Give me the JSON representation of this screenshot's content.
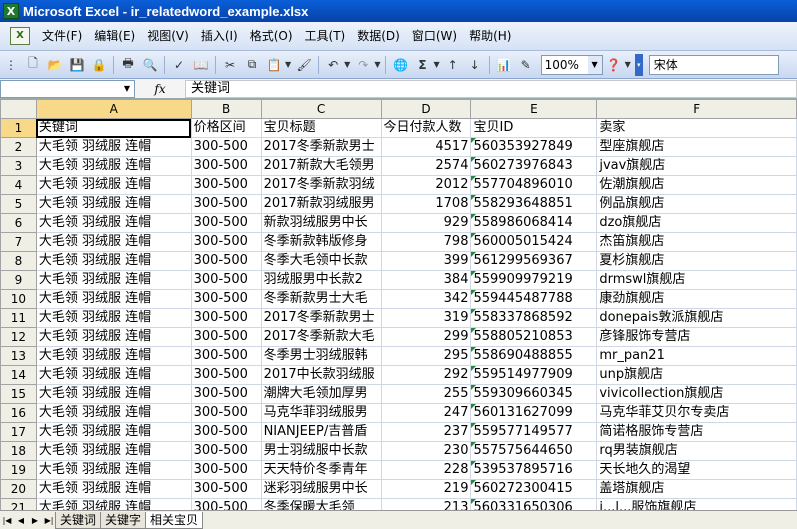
{
  "window": {
    "title": "Microsoft Excel - ir_relatedword_example.xlsx",
    "app_icon": "excel-icon"
  },
  "menu": [
    "文件(F)",
    "编辑(E)",
    "视图(V)",
    "插入(I)",
    "格式(O)",
    "工具(T)",
    "数据(D)",
    "窗口(W)",
    "帮助(H)"
  ],
  "toolbar": {
    "zoom": "100%",
    "font": "宋体",
    "sum_label": "Σ"
  },
  "formula_bar": {
    "name_box": "",
    "fx_label": "fx",
    "content": "关键词"
  },
  "columns": [
    "A",
    "B",
    "C",
    "D",
    "E",
    "F"
  ],
  "rows": [
    {
      "n": "1",
      "cells": [
        "关键词",
        "价格区间",
        "宝贝标题",
        "今日付款人数",
        "宝贝ID",
        "卖家"
      ]
    },
    {
      "n": "2",
      "cells": [
        "大毛领 羽绒服 连帽",
        "300-500",
        "2017冬季新款男士",
        "4517",
        "560353927849",
        "型座旗舰店"
      ]
    },
    {
      "n": "3",
      "cells": [
        "大毛领 羽绒服 连帽",
        "300-500",
        "2017新款大毛领男",
        "2574",
        "560273976843",
        "jvav旗舰店"
      ]
    },
    {
      "n": "4",
      "cells": [
        "大毛领 羽绒服 连帽",
        "300-500",
        "2017冬季新款羽绒",
        "2012",
        "557704896010",
        "佐潮旗舰店"
      ]
    },
    {
      "n": "5",
      "cells": [
        "大毛领 羽绒服 连帽",
        "300-500",
        "2017新款羽绒服男",
        "1708",
        "558293648851",
        "例品旗舰店"
      ]
    },
    {
      "n": "6",
      "cells": [
        "大毛领 羽绒服 连帽",
        "300-500",
        "新款羽绒服男中长",
        "929",
        "558986068414",
        "dzo旗舰店"
      ]
    },
    {
      "n": "7",
      "cells": [
        "大毛领 羽绒服 连帽",
        "300-500",
        "冬季新款韩版修身",
        "798",
        "560005015424",
        "杰笛旗舰店"
      ]
    },
    {
      "n": "8",
      "cells": [
        "大毛领 羽绒服 连帽",
        "300-500",
        "冬季大毛领中长款",
        "399",
        "561299569367",
        "夏杉旗舰店"
      ]
    },
    {
      "n": "9",
      "cells": [
        "大毛领 羽绒服 连帽",
        "300-500",
        "羽绒服男中长款2",
        "384",
        "559909979219",
        "drmswl旗舰店"
      ]
    },
    {
      "n": "10",
      "cells": [
        "大毛领 羽绒服 连帽",
        "300-500",
        "冬季新款男士大毛",
        "342",
        "559445487788",
        "康劲旗舰店"
      ]
    },
    {
      "n": "11",
      "cells": [
        "大毛领 羽绒服 连帽",
        "300-500",
        "2017冬季新款男士",
        "319",
        "558337868592",
        "donepais敦派旗舰店"
      ]
    },
    {
      "n": "12",
      "cells": [
        "大毛领 羽绒服 连帽",
        "300-500",
        "2017冬季新款大毛",
        "299",
        "558805210853",
        "彦锋服饰专营店"
      ]
    },
    {
      "n": "13",
      "cells": [
        "大毛领 羽绒服 连帽",
        "300-500",
        "冬季男士羽绒服韩",
        "295",
        "558690488855",
        "mr_pan21"
      ]
    },
    {
      "n": "14",
      "cells": [
        "大毛领 羽绒服 连帽",
        "300-500",
        "2017中长款羽绒服",
        "292",
        "559514977909",
        "unp旗舰店"
      ]
    },
    {
      "n": "15",
      "cells": [
        "大毛领 羽绒服 连帽",
        "300-500",
        "潮牌大毛领加厚男",
        "255",
        "559309660345",
        "vivicollection旗舰店"
      ]
    },
    {
      "n": "16",
      "cells": [
        "大毛领 羽绒服 连帽",
        "300-500",
        "马克华菲羽绒服男",
        "247",
        "560131627099",
        "马克华菲艾贝尔专卖店"
      ]
    },
    {
      "n": "17",
      "cells": [
        "大毛领 羽绒服 连帽",
        "300-500",
        "NIANJEEP/吉普盾",
        "237",
        "559577149577",
        "简诺格服饰专营店"
      ]
    },
    {
      "n": "18",
      "cells": [
        "大毛领 羽绒服 连帽",
        "300-500",
        "男士羽绒服中长款",
        "230",
        "557575644650",
        "rq男装旗舰店"
      ]
    },
    {
      "n": "19",
      "cells": [
        "大毛领 羽绒服 连帽",
        "300-500",
        "天天特价冬季青年",
        "228",
        "539537895716",
        "天长地久的渴望"
      ]
    },
    {
      "n": "20",
      "cells": [
        "大毛领 羽绒服 连帽",
        "300-500",
        "迷彩羽绒服男中长",
        "219",
        "560272300415",
        "盖塔旗舰店"
      ]
    },
    {
      "n": "21",
      "cells": [
        "大毛领 羽绒服 连帽",
        "300-500",
        "冬季保暖大毛领",
        "213",
        "560331650306",
        "j...l...服饰旗舰店"
      ]
    }
  ],
  "sheet_tabs": [
    {
      "label": "关键词",
      "active": false
    },
    {
      "label": "关键字",
      "active": false
    },
    {
      "label": "相关宝贝",
      "active": true
    }
  ]
}
